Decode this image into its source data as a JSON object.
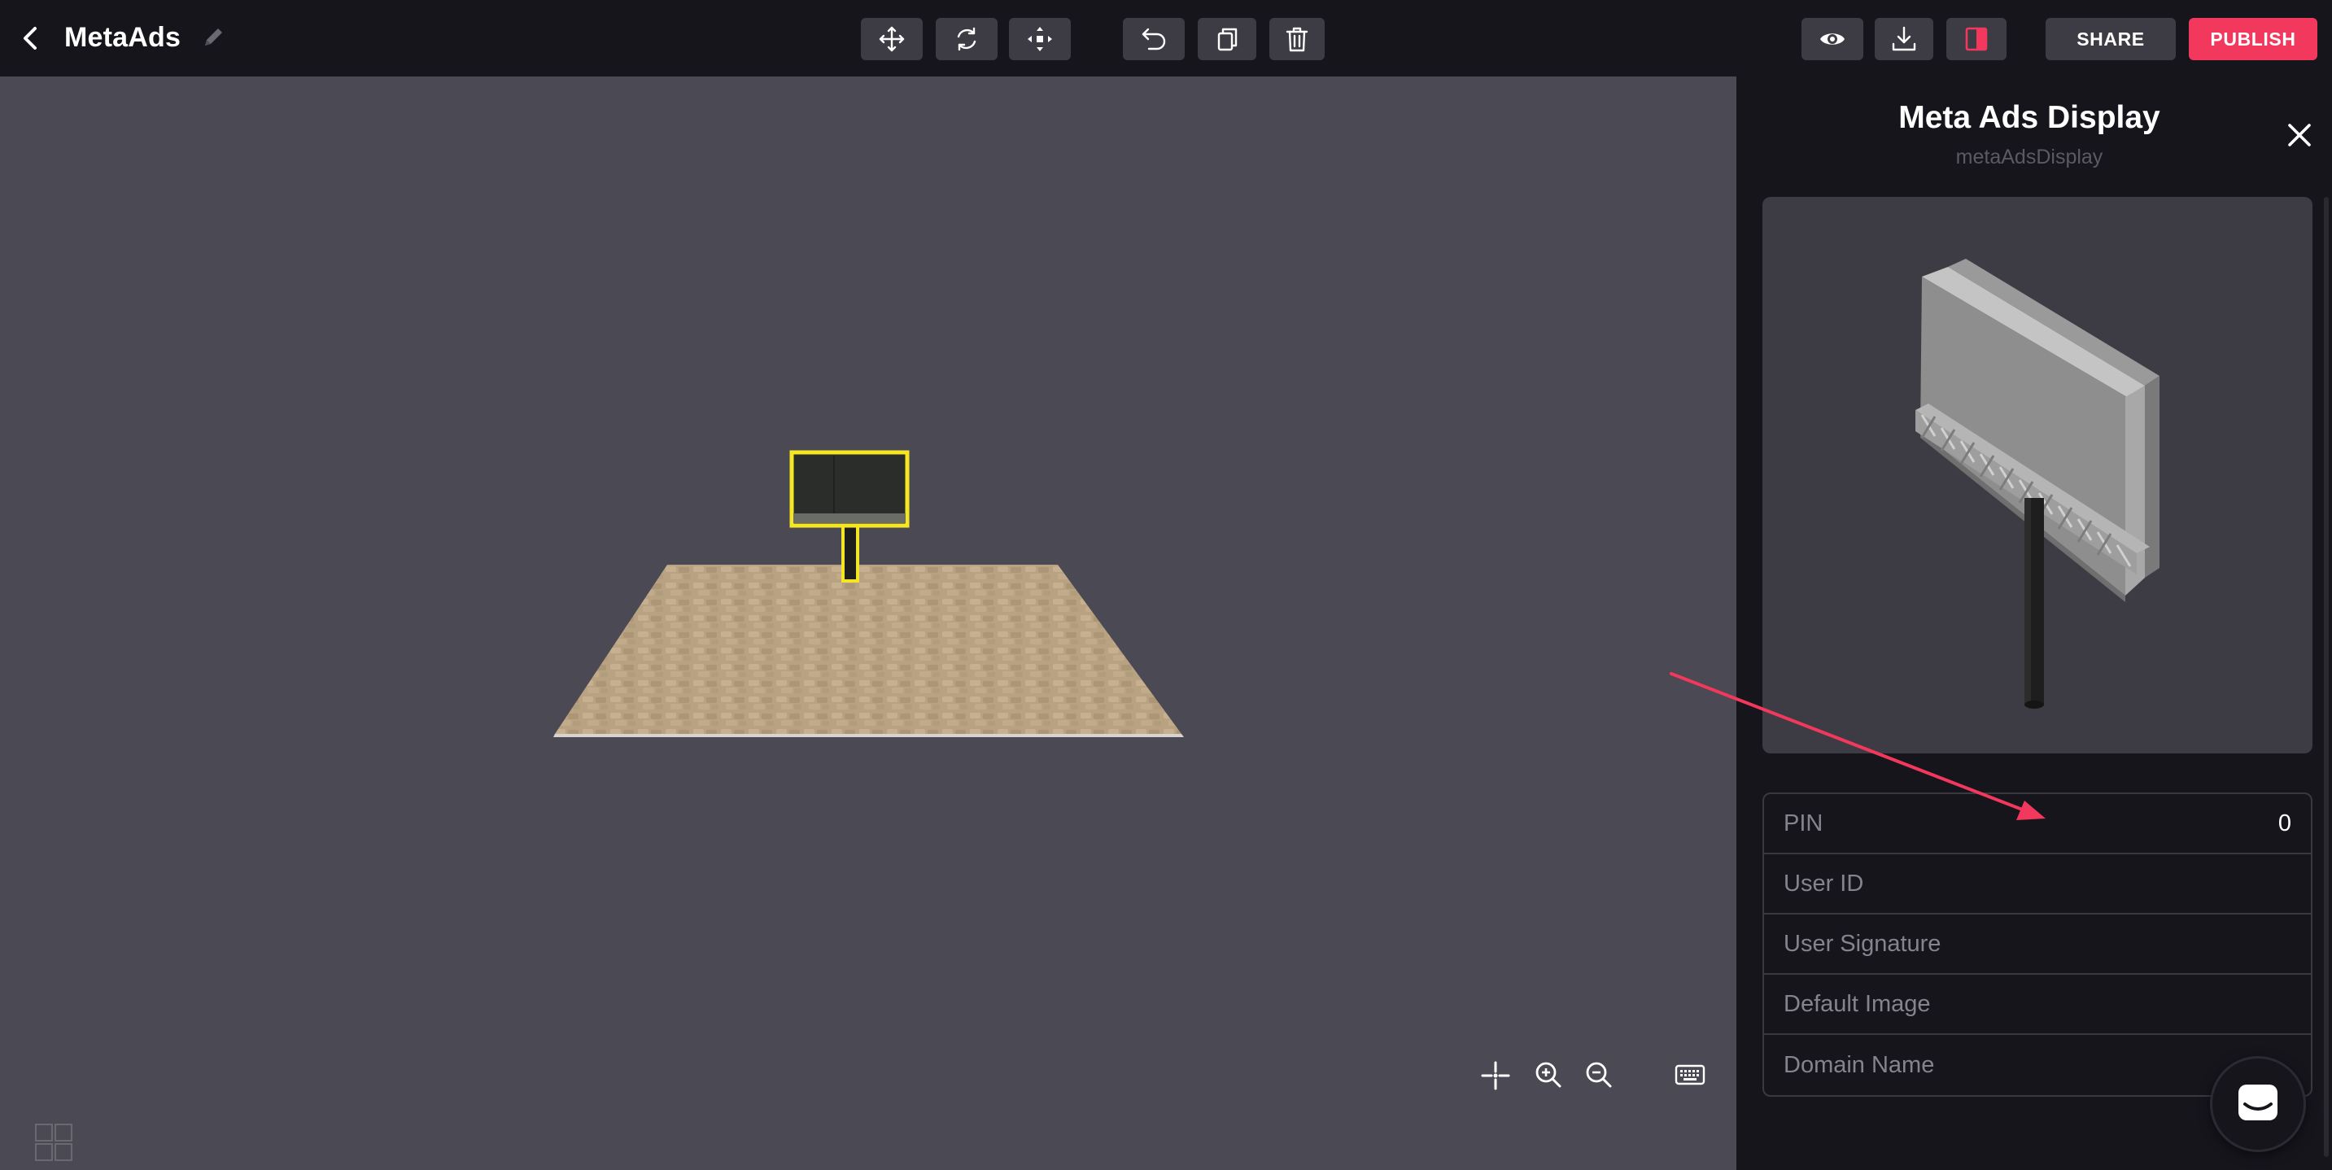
{
  "header": {
    "project_title": "MetaAds"
  },
  "toolbar": {
    "tools": [
      {
        "name": "move",
        "icon": "move-arrows-icon"
      },
      {
        "name": "rotate",
        "icon": "rotate-icon"
      },
      {
        "name": "scale",
        "icon": "scale-icon"
      },
      {
        "name": "undo",
        "icon": "undo-icon"
      },
      {
        "name": "duplicate",
        "icon": "copy-icon"
      },
      {
        "name": "delete",
        "icon": "trash-icon"
      }
    ],
    "right_tools": [
      {
        "name": "preview",
        "icon": "eye-icon"
      },
      {
        "name": "download",
        "icon": "download-icon"
      },
      {
        "name": "toggle-panel",
        "icon": "panel-toggle-icon"
      }
    ],
    "share_label": "SHARE",
    "publish_label": "PUBLISH"
  },
  "viewport": {
    "bottom_tools": [
      {
        "name": "center",
        "icon": "crosshair-icon"
      },
      {
        "name": "zoom-in",
        "icon": "zoom-in-icon"
      },
      {
        "name": "zoom-out",
        "icon": "zoom-out-icon"
      },
      {
        "name": "keyboard",
        "icon": "keyboard-icon"
      }
    ],
    "selected_object": "billboard"
  },
  "panel": {
    "title": "Meta Ads Display",
    "subtitle": "metaAdsDisplay",
    "properties": [
      {
        "label": "PIN",
        "value": "0"
      },
      {
        "label": "User ID",
        "value": ""
      },
      {
        "label": "User Signature",
        "value": ""
      },
      {
        "label": "Default Image",
        "value": ""
      },
      {
        "label": "Domain Name",
        "value": ""
      }
    ]
  },
  "colors": {
    "accent": "#f2385d",
    "selection": "#f5e623",
    "panel_bg": "#16151c",
    "viewport_bg": "#4b4953"
  }
}
